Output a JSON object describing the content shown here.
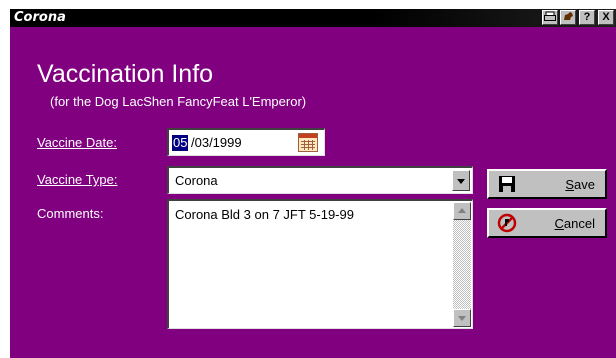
{
  "window": {
    "title": "Corona",
    "title_buttons": [
      {
        "name": "print-icon",
        "glyph": "▤"
      },
      {
        "name": "dog-icon",
        "glyph": "■"
      },
      {
        "name": "help-icon",
        "glyph": "?"
      },
      {
        "name": "close-icon",
        "glyph": "X"
      }
    ]
  },
  "form": {
    "heading": "Vaccination Info",
    "subheading": "(for the Dog LacShen FancyFeat L'Emperor)",
    "vaccine_date_label": "Vaccine Date:",
    "vaccine_date_month": "05",
    "vaccine_date_rest": "/03/1999",
    "vaccine_type_label": "Vaccine Type:",
    "vaccine_type_value": "Corona",
    "comments_label": "Comments:",
    "comments_value": "Corona Bld 3 on 7 JFT 5-19-99"
  },
  "buttons": {
    "save_hotkey": "S",
    "save_rest": "ave",
    "cancel_hotkey": "C",
    "cancel_rest": "ancel"
  },
  "colors": {
    "background": "#800080",
    "titlebar": "#000000",
    "selection": "#000080"
  }
}
